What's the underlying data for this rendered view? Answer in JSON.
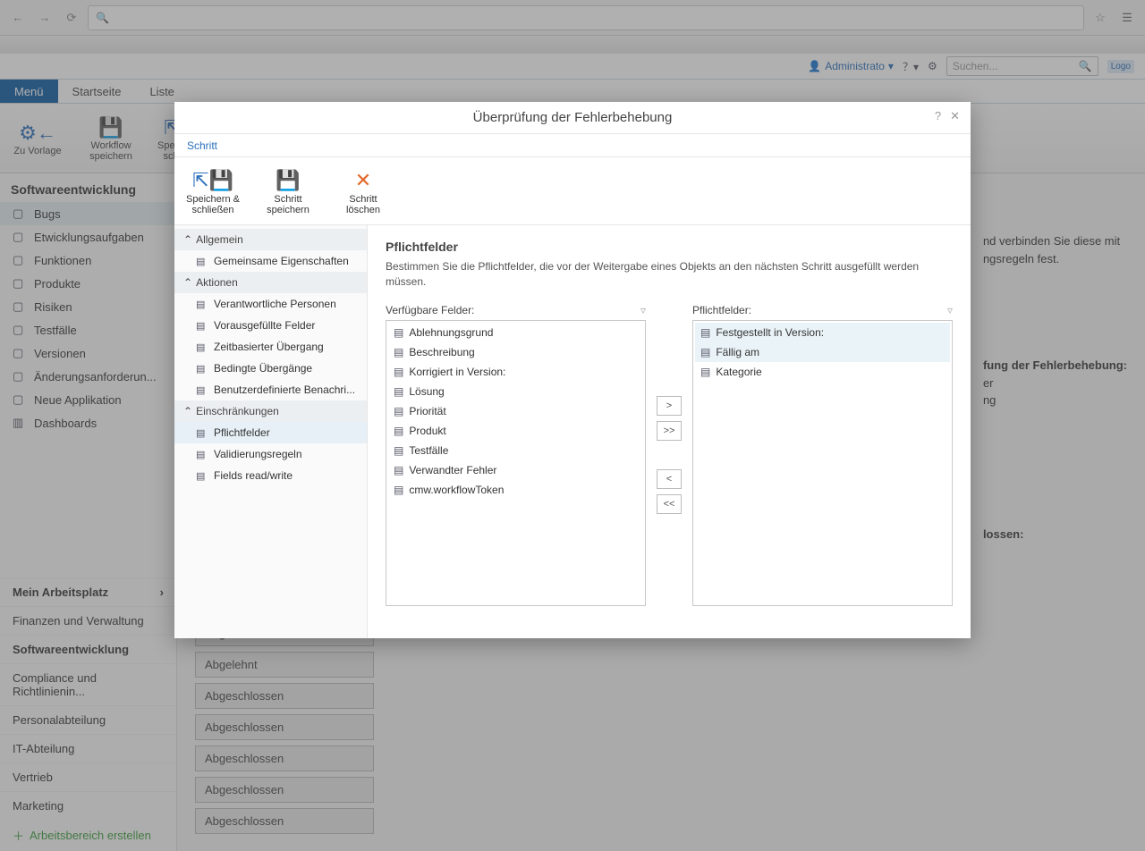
{
  "browser": {
    "placeholder": ""
  },
  "top": {
    "admin": "Administrato",
    "search_placeholder": "Suchen...",
    "logo": "Logo"
  },
  "tabs": {
    "menu": "Menü",
    "start": "Startseite",
    "list": "Liste"
  },
  "ribbon": {
    "to_template": "Zu Vorlage",
    "save_workflow": "Workflow speichern",
    "save_close_partial": "Speichern &\nschließen"
  },
  "sidebar": {
    "heading": "Softwareentwicklung",
    "items": [
      "Bugs",
      "Etwicklungsaufgaben",
      "Funktionen",
      "Produkte",
      "Risiken",
      "Testfälle",
      "Versionen",
      "Änderungsanforderun...",
      "Neue Applikation",
      "Dashboards"
    ],
    "workspaces_heading": "Mein Arbeitsplatz",
    "workspaces": [
      "Finanzen und Verwaltung",
      "Softwareentwicklung",
      "Compliance und Richtlinienin...",
      "Personalabteilung",
      "IT-Abteilung",
      "Vertrieb",
      "Marketing"
    ],
    "create_workspace": "Arbeitsbereich erstellen"
  },
  "content_bg": {
    "line1": "nd verbinden Sie diese mit",
    "line2": "ngsregeln fest.",
    "box_title": "fung der Fehlerbehebung:",
    "box_sub1": "er",
    "box_sub2": "ng",
    "box2_title": "lossen:"
  },
  "statuses": [
    "Abgelehnt",
    "Abgelehnt",
    "Abgeschlossen",
    "Abgeschlossen",
    "Abgeschlossen",
    "Abgeschlossen",
    "Abgeschlossen"
  ],
  "modal": {
    "title": "Überprüfung der Fehlerbehebung",
    "subtab": "Schritt",
    "toolbar": {
      "save_close": "Speichern & schließen",
      "save_step": "Schritt speichern",
      "delete_step": "Schritt löschen"
    },
    "side": {
      "g1": "Allgemein",
      "g1_items": [
        "Gemeinsame Eigenschaften"
      ],
      "g2": "Aktionen",
      "g2_items": [
        "Verantwortliche Personen",
        "Vorausgefüllte Felder",
        "Zeitbasierter Übergang",
        "Bedingte Übergänge",
        "Benutzerdefinierte Benachri..."
      ],
      "g3": "Einschränkungen",
      "g3_items": [
        "Pflichtfelder",
        "Validierungsregeln",
        "Fields read/write"
      ]
    },
    "panel": {
      "heading": "Pflichtfelder",
      "desc": "Bestimmen Sie die Pflichtfelder, die vor der Weitergabe eines Objekts an den nächsten Schritt ausgefüllt werden müssen.",
      "available_label": "Verfügbare Felder:",
      "required_label": "Pflichtfelder:",
      "available": [
        "Ablehnungsgrund",
        "Beschreibung",
        "Korrigiert in Version:",
        "Lösung",
        "Priorität",
        "Produkt",
        "Testfälle",
        "Verwandter Fehler",
        "cmw.workflowToken"
      ],
      "required": [
        "Festgestellt in Version:",
        "Fällig am",
        "Kategorie"
      ],
      "btns": {
        "add": ">",
        "addall": ">>",
        "remove": "<",
        "removeall": "<<"
      }
    }
  }
}
